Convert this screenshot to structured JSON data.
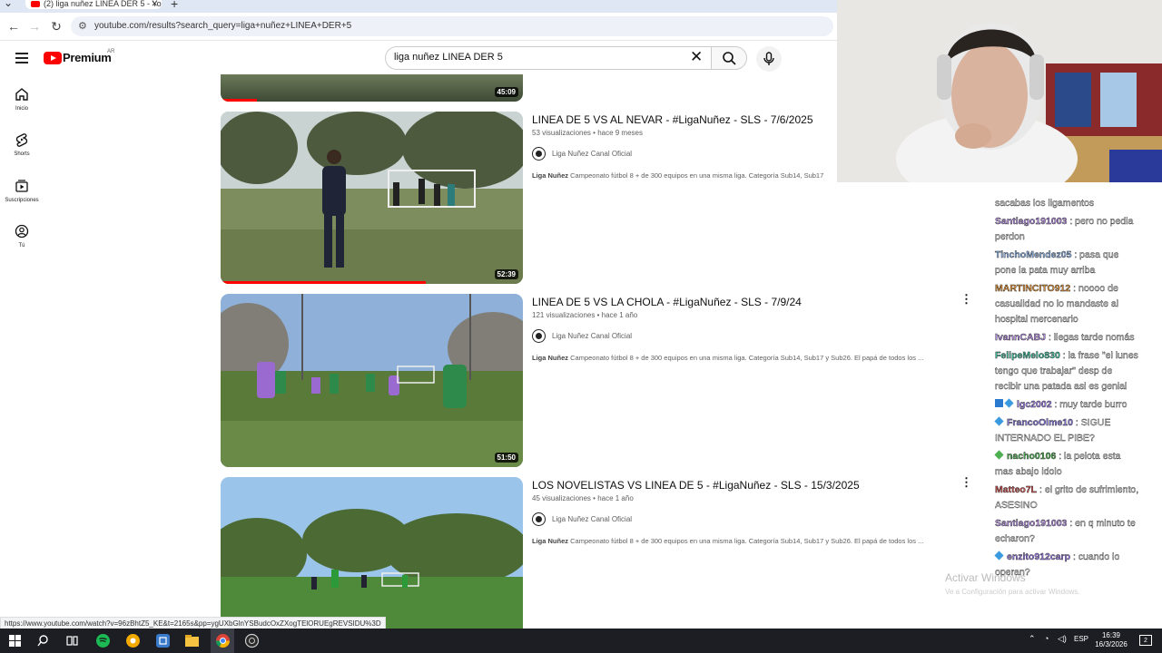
{
  "browser": {
    "tab_title": "(2) liga nuñez LINEA DER 5 - Yo",
    "url": "youtube.com/results?search_query=liga+nuñez+LINEA+DER+5",
    "status_url": "https://www.youtube.com/watch?v=96zBhtZ5_KE&t=2165s&pp=ygUXbGlnYSBudcOxZXogTElORUEgREVSIDU%3D"
  },
  "youtube": {
    "logo_text": "Premium",
    "country_code": "AR",
    "search_query": "liga nuñez LINEA DER 5",
    "sidebar": [
      {
        "label": "Inicio",
        "icon": "home-icon"
      },
      {
        "label": "Shorts",
        "icon": "shorts-icon"
      },
      {
        "label": "Suscripciones",
        "icon": "subscriptions-icon"
      },
      {
        "label": "Tú",
        "icon": "you-icon"
      }
    ]
  },
  "videos": [
    {
      "duration": "45:09",
      "watched": 0.12
    },
    {
      "title": "LINEA DE 5 VS AL NEVAR - #LigaNuñez - SLS - 7/6/2025",
      "views": "53 visualizaciones",
      "age": "hace 9 meses",
      "channel": "Liga Nuñez Canal Oficial",
      "desc_bold": "Liga Nuñez",
      "desc": "Campeonato fútbol 8 + de 300 equipos en una misma liga. Categoría Sub14, Sub17",
      "duration": "52:39",
      "watched": 0.68
    },
    {
      "title": "LINEA DE 5 VS LA CHOLA - #LigaNuñez - SLS - 7/9/24",
      "views": "121 visualizaciones",
      "age": "hace 1 año",
      "channel": "Liga Nuñez Canal Oficial",
      "desc_bold": "Liga Nuñez",
      "desc": "Campeonato fútbol 8 + de 300 equipos en una misma liga. Categoría Sub14, Sub17 y Sub26. El papá de todos los ...",
      "duration": "51:50"
    },
    {
      "title": "LOS NOVELISTAS VS LINEA DE 5 - #LigaNuñez - SLS - 15/3/2025",
      "views": "45 visualizaciones",
      "age": "hace 1 año",
      "channel": "Liga Nuñez Canal Oficial",
      "desc_bold": "Liga Nuñez",
      "desc": "Campeonato fútbol 8 + de 300 equipos en una misma liga. Categoría Sub14, Sub17 y Sub26. El papá de todos los ..."
    }
  ],
  "chat": [
    {
      "user": "",
      "text": "sacabas los ligamentos",
      "color": "#ffffff"
    },
    {
      "user": "Santiago191003",
      "text": ": pero no pedia perdon",
      "color": "#b18ae0"
    },
    {
      "user": "TinchoMendez05",
      "text": ": pasa que pone la pata muy arriba",
      "color": "#8fb4e8"
    },
    {
      "user": "MARTINCITO912",
      "text": ": noooo de casualidad no lo mandaste al hospital mercenario",
      "color": "#e0923a"
    },
    {
      "user": "IvannCABJ",
      "text": ": llegas tarde nomás",
      "color": "#b18ae0"
    },
    {
      "user": "FelipeMelo830",
      "text": ": la frase \"el lunes tengo que trabajar\" desp de recibir una patada asi es genial",
      "color": "#3bbf9a"
    },
    {
      "user": "lgc2002",
      "text": ": muy tarde burro",
      "color": "#9a7ae8"
    },
    {
      "user": "FrancoOlme10",
      "text": ": SIGUE INTERNADO EL PIBE?",
      "color": "#8a7ae0"
    },
    {
      "user": "nacho0106",
      "text": ": la pelota esta mas abajo idolo",
      "color": "#4caf50"
    },
    {
      "user": "Matteo7L",
      "text": ": el grito de sufrimiento, ASESINO",
      "color": "#d05050"
    },
    {
      "user": "Santiago191003",
      "text": ": en q minuto te echaron?",
      "color": "#b18ae0"
    },
    {
      "user": "enzito912carp",
      "text": ": cuando lo operan?",
      "color": "#9a7ae8"
    }
  ],
  "windows_watermark": {
    "title": "Activar Windows",
    "subtitle": "Ve a Configuración para activar Windows."
  },
  "taskbar": {
    "lang": "ESP",
    "time": "16:39",
    "date": "16/3/2026",
    "notifications": "2"
  }
}
